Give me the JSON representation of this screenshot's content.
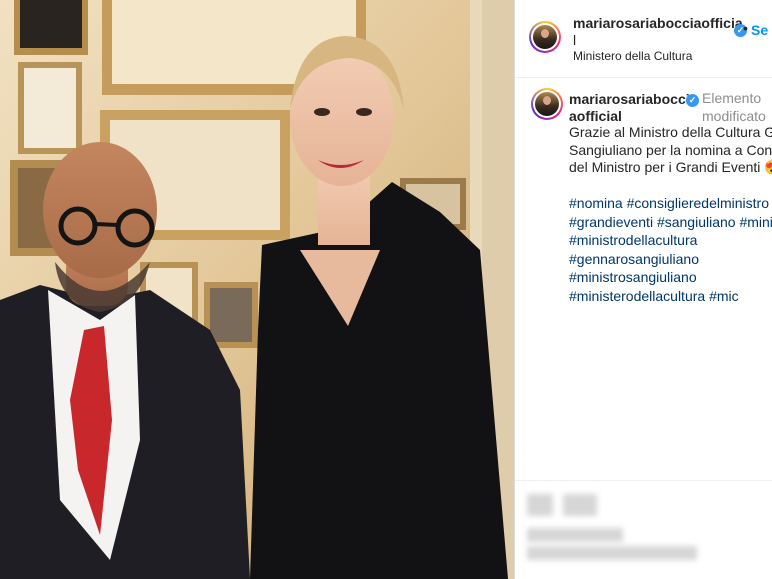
{
  "post": {
    "username_line1": "mariarosariabocciaofficia",
    "username_line2": "l",
    "location": "Ministero della Cultura",
    "follow_dot": "•",
    "follow_label": "Se",
    "verified_icon": "verified-badge-icon",
    "verified_glyph": "✓"
  },
  "comment": {
    "username_line1": "mariarosariabocci",
    "username_line2": "aofficial",
    "edited_line1": "Elemento",
    "edited_line2": "modificato",
    "caption_lines": [
      "Grazie al Ministro della Cultura Ge",
      "Sangiuliano per la nomina a Consi",
      "del Ministro per i Grandi Eventi 😍"
    ],
    "hashtag_lines": [
      "#nomina #consiglieredelministro",
      "#grandieventi #sangiuliano #minis",
      "#ministrodellacultura",
      "#gennarosangiuliano",
      "#ministrosangiuliano",
      "#ministerodellacultura #mic"
    ]
  },
  "colors": {
    "link": "#00376b",
    "follow": "#0095f6",
    "verified": "#3897f0",
    "text": "#262626",
    "muted": "#8e8e8e"
  }
}
